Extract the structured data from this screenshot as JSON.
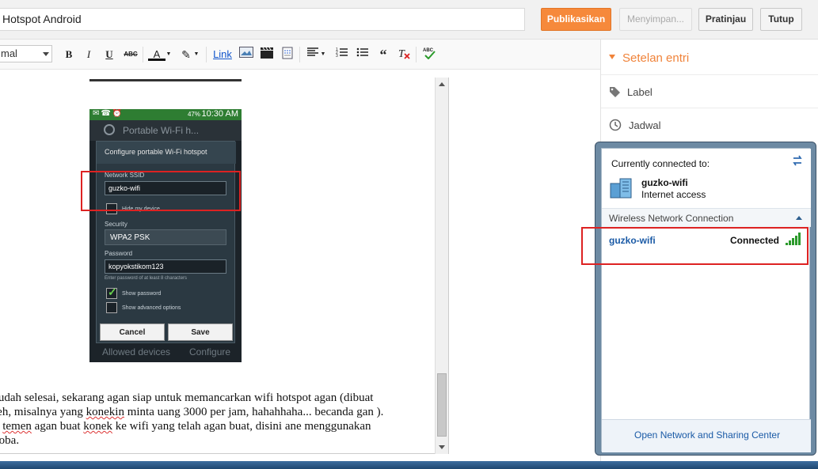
{
  "header": {
    "post_title": "Hotspot Android",
    "publish_label": "Publikasikan",
    "saving_label": "Menyimpan...",
    "preview_label": "Pratinjau",
    "close_label": "Tutup"
  },
  "toolbar": {
    "format_value": "mal",
    "bold": "B",
    "italic": "I",
    "underline": "U",
    "strike": "ABC",
    "text_color": "A",
    "link_label": "Link",
    "spellcheck": "ABC"
  },
  "editor": {
    "lines": [
      "sudah selesai, sekarang agan siap untuk memancarkan wifi hotspot agan (dibuat",
      "leh, misalnya yang ",
      "konekin",
      " minta uang 3000 per jam, hahahhaha... becanda gan ).",
      "h ",
      "temen",
      " agan buat ",
      "konek",
      " ke wifi yang telah agan buat, disini ane menggunakan",
      "coba."
    ]
  },
  "phone": {
    "time": "10:30 AM",
    "battery": "47%",
    "actionbar_title": "Portable Wi-Fi h...",
    "dialog_title": "Configure portable Wi-Fi hotspot",
    "ssid_label": "Network SSID",
    "ssid_value": "guzko-wifi",
    "hide_label": "Hide my device",
    "security_label": "Security",
    "security_value": "WPA2 PSK",
    "password_label": "Password",
    "password_value": "kopyokstikom123",
    "password_hint": "Enter password of at least 8 characters",
    "show_password": "Show password",
    "show_advanced": "Show advanced options",
    "cancel": "Cancel",
    "save": "Save",
    "allowed_devices": "Allowed devices",
    "configure": "Configure"
  },
  "sidebar": {
    "heading": "Setelan entri",
    "label_item": "Label",
    "schedule_item": "Jadwal"
  },
  "network": {
    "currently_connected": "Currently connected to:",
    "network_name": "guzko-wifi",
    "access": "Internet access",
    "section_title": "Wireless Network Connection",
    "wifi_name": "guzko-wifi",
    "status": "Connected",
    "footer_link": "Open Network and Sharing Center"
  },
  "colors": {
    "accent_orange": "#f6893b",
    "link_blue": "#1a5aa6",
    "highlight_red": "#d22222"
  }
}
